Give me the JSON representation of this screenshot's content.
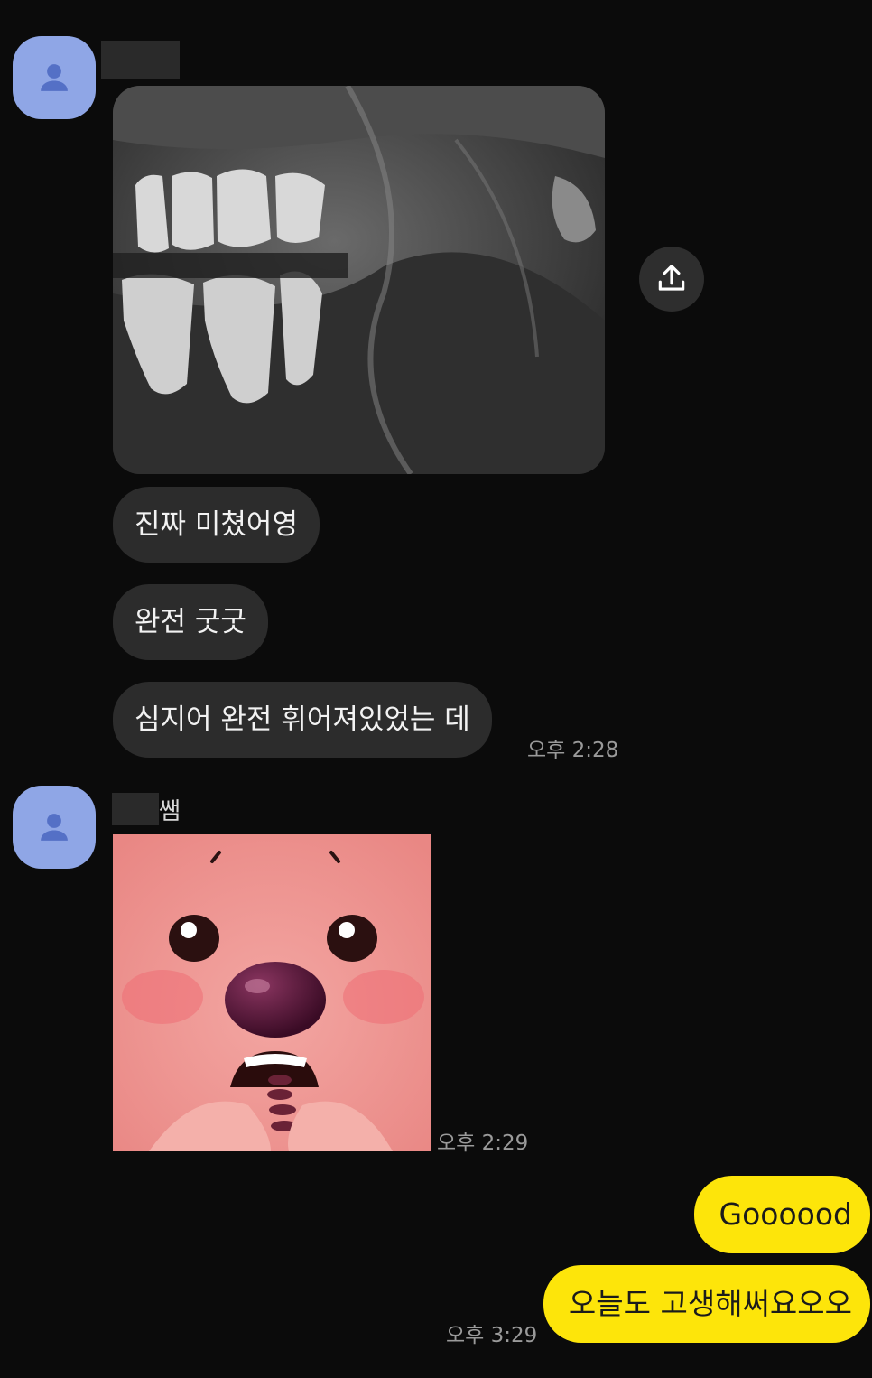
{
  "thread": {
    "sender2_name_suffix": "쌤"
  },
  "messages_in_1": {
    "text1": "진짜 미쳤어영",
    "text2": "완전 굿굿",
    "text3": "심지어 완전 휘어져있었는 데",
    "time": "오후 2:28"
  },
  "messages_in_2": {
    "time": "오후 2:29"
  },
  "messages_out": {
    "text1": "Goooood",
    "text2": "오늘도 고생해써요오오",
    "time": "오후 3:29"
  },
  "icons": {
    "avatar": "person-icon",
    "share": "share-upload-icon"
  },
  "colors": {
    "background": "#0b0b0b",
    "incoming_bubble": "#2c2c2c",
    "outgoing_bubble": "#fde50a",
    "avatar": "#8fa6e6"
  }
}
